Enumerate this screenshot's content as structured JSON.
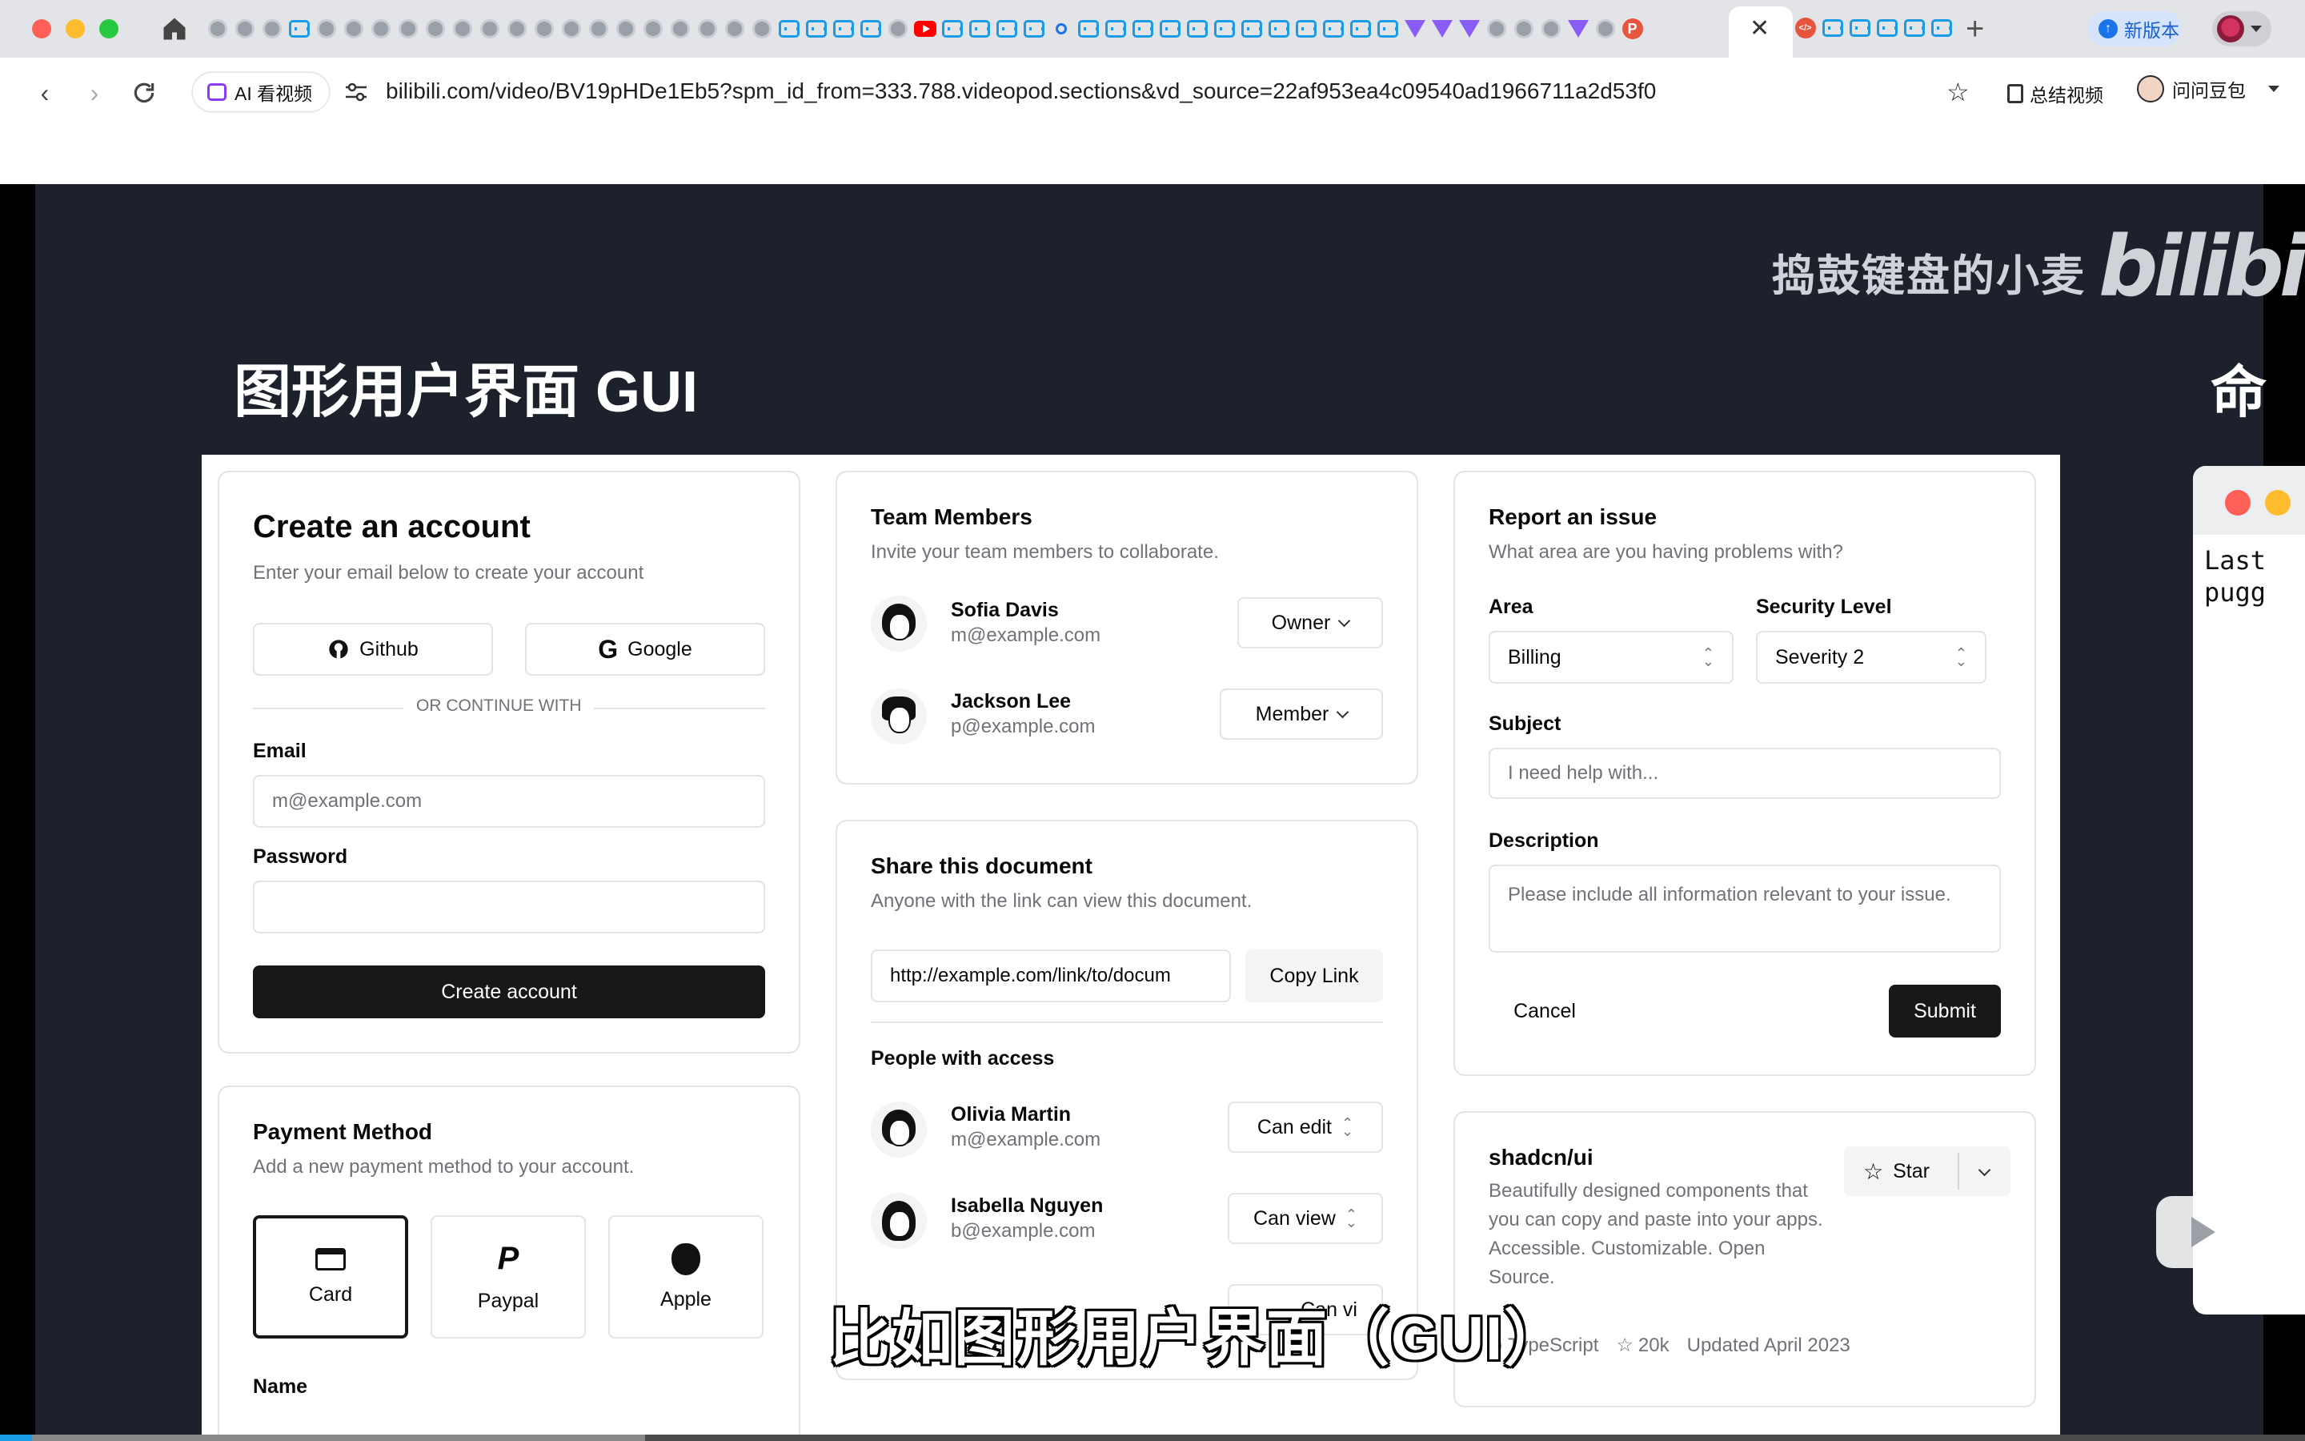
{
  "browser": {
    "active_tab_close": "✕",
    "new_tab": "+",
    "new_version": "新版本",
    "ai_video": "AI 看视频",
    "url": "bilibili.com/video/BV19pHDe1Eb5?spm_id_from=333.788.videopod.sections&vd_source=22af953ea4c09540ad1966711a2d53f0",
    "summarize": "总结视频",
    "doubao": "问问豆包",
    "favicons": [
      "gray",
      "gray",
      "gray",
      "bili",
      "gray",
      "gray",
      "gray",
      "gray",
      "gray",
      "gray",
      "gray",
      "gray",
      "gray",
      "gray",
      "gray",
      "gray",
      "gray",
      "gray",
      "gray",
      "gray",
      "gray",
      "bili",
      "bili",
      "bili",
      "bili",
      "gray",
      "youtube",
      "bili",
      "bili",
      "bili",
      "bili",
      "search",
      "bili",
      "bili",
      "bili",
      "bili",
      "bili",
      "bili",
      "bili",
      "bili",
      "bili",
      "bili",
      "bili",
      "bili",
      "vite",
      "vite",
      "vite",
      "gray",
      "gray",
      "gray",
      "vite",
      "gray",
      "p"
    ],
    "favicons_after": [
      "code",
      "bili",
      "bili",
      "bili",
      "bili",
      "bili"
    ]
  },
  "video": {
    "uploader": "捣鼓键盘的小麦",
    "logo": "bilibili",
    "slide_title": "图形用户界面 GUI",
    "slide_title_right": "命",
    "subtitle": "比如图形用户界面（GUI）",
    "progress": 0.28,
    "terminal_text": "Last\npugg"
  },
  "create_account": {
    "title": "Create an account",
    "description": "Enter your email below to create your account",
    "github": "Github",
    "google": "Google",
    "divider": "OR CONTINUE WITH",
    "email_label": "Email",
    "email_placeholder": "m@example.com",
    "password_label": "Password",
    "submit": "Create account"
  },
  "payment": {
    "title": "Payment Method",
    "description": "Add a new payment method to your account.",
    "options": [
      "Card",
      "Paypal",
      "Apple"
    ],
    "name_label": "Name"
  },
  "team": {
    "title": "Team Members",
    "description": "Invite your team members to collaborate.",
    "members": [
      {
        "name": "Sofia Davis",
        "email": "m@example.com",
        "role": "Owner"
      },
      {
        "name": "Jackson Lee",
        "email": "p@example.com",
        "role": "Member"
      }
    ]
  },
  "share": {
    "title": "Share this document",
    "description": "Anyone with the link can view this document.",
    "link": "http://example.com/link/to/docum",
    "copy": "Copy Link",
    "people_label": "People with access",
    "people": [
      {
        "name": "Olivia Martin",
        "email": "m@example.com",
        "access": "Can edit"
      },
      {
        "name": "Isabella Nguyen",
        "email": "b@example.com",
        "access": "Can view"
      }
    ],
    "third_access": "Can vi"
  },
  "report": {
    "title": "Report an issue",
    "description": "What area are you having problems with?",
    "area_label": "Area",
    "area_value": "Billing",
    "security_label": "Security Level",
    "security_value": "Severity 2",
    "subject_label": "Subject",
    "subject_placeholder": "I need help with...",
    "description_label": "Description",
    "description_placeholder": "Please include all information relevant to your issue.",
    "cancel": "Cancel",
    "submit": "Submit"
  },
  "repo": {
    "title": "shadcn/ui",
    "description": "Beautifully designed components that you can copy and paste into your apps. Accessible. Customizable. Open Source.",
    "star": "Star",
    "language": "TypeScript",
    "stars": "20k",
    "updated": "Updated April 2023"
  }
}
